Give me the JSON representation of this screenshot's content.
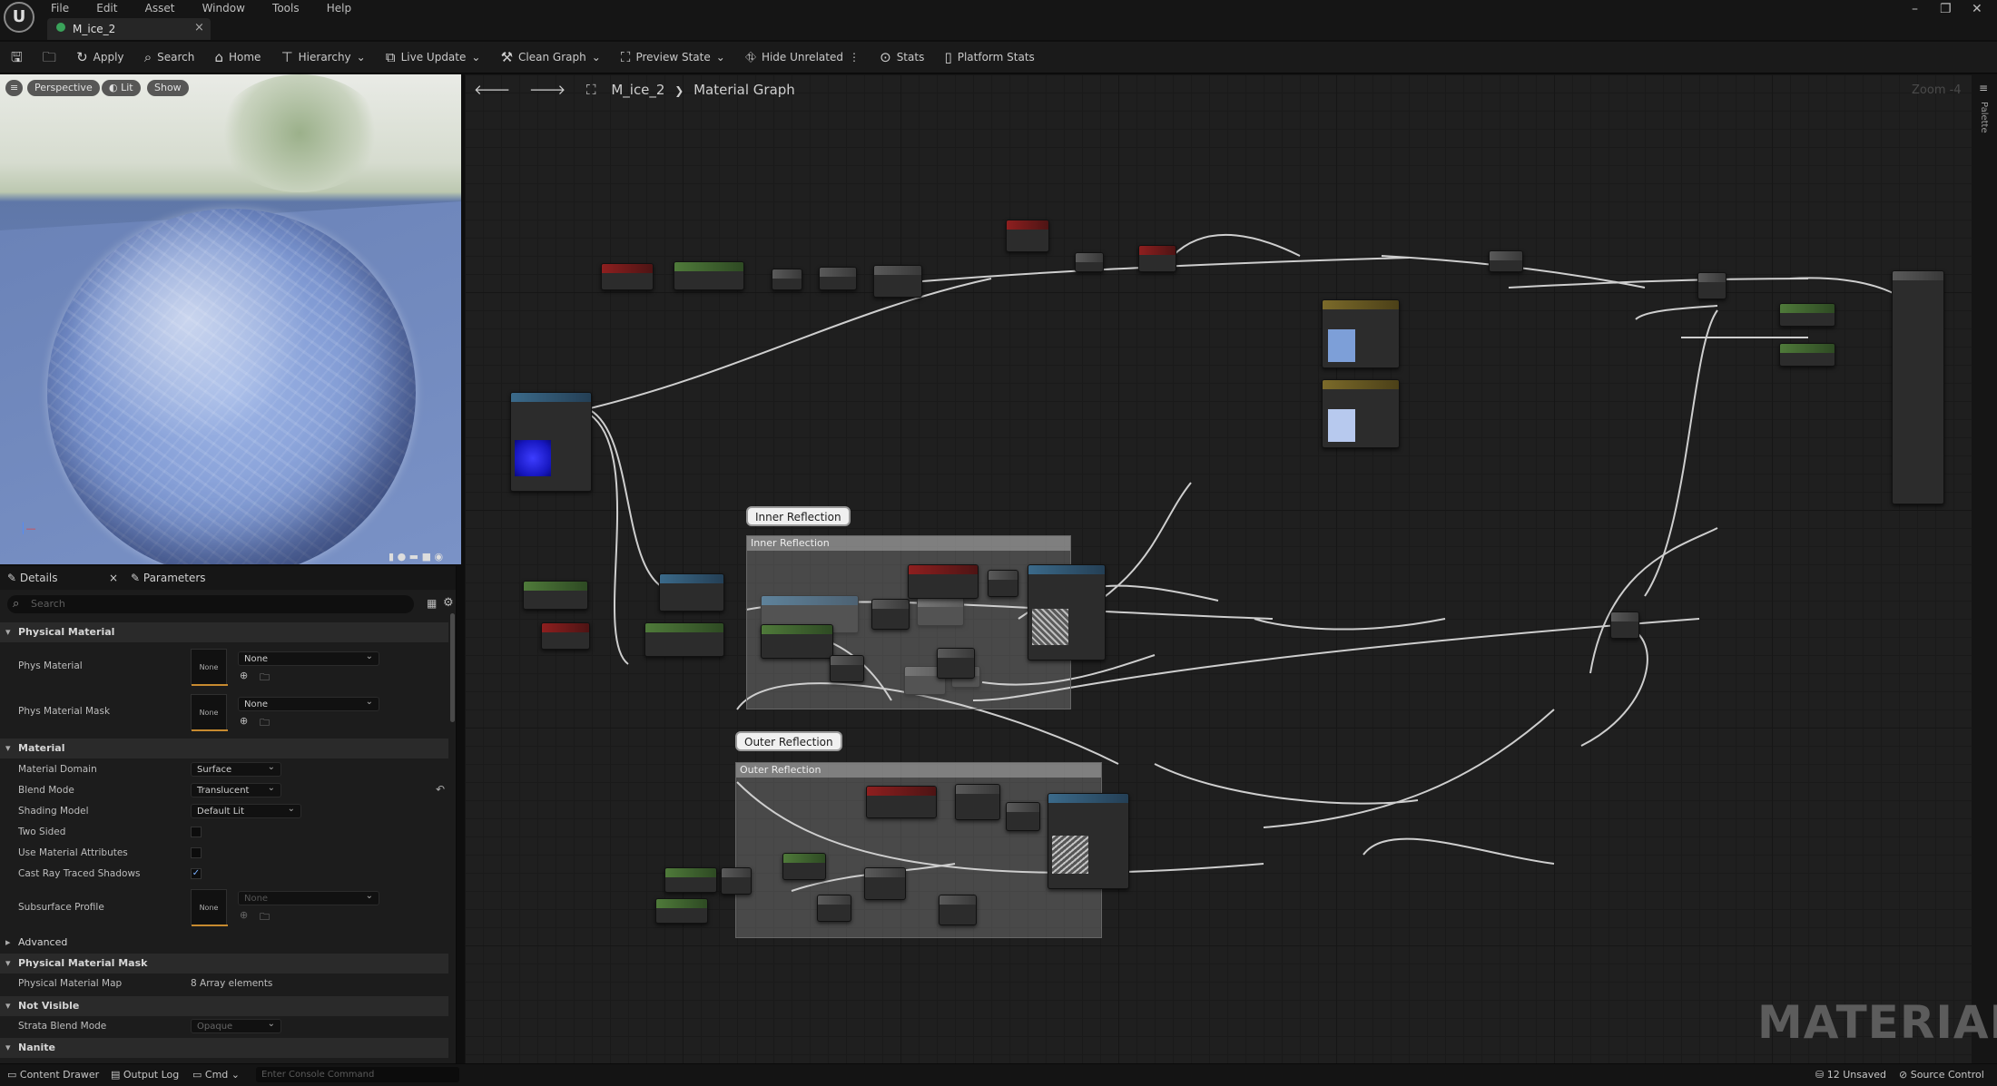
{
  "menu": [
    "File",
    "Edit",
    "Asset",
    "Window",
    "Tools",
    "Help"
  ],
  "logo": "U",
  "asset_tab": {
    "title": "M_ice_2",
    "close": "×"
  },
  "window_controls": {
    "minimize": "–",
    "restore": "❐",
    "close": "✕"
  },
  "toolbar": {
    "apply": "Apply",
    "search": "Search",
    "home": "Home",
    "hierarchy": "Hierarchy",
    "live_update": "Live Update",
    "clean_graph": "Clean Graph",
    "preview_state": "Preview State",
    "hide_unrelated": "Hide Unrelated",
    "stats": "Stats",
    "platform_stats": "Platform Stats"
  },
  "viewport": {
    "perspective": "Perspective",
    "lit": "Lit",
    "show": "Show"
  },
  "details": {
    "tab_details": "Details",
    "tab_close": "×",
    "tab_parameters": "Parameters",
    "search_placeholder": "Search",
    "sections": {
      "physical_material": "Physical Material",
      "material": "Material",
      "advanced": "Advanced",
      "physical_material_mask": "Physical Material Mask",
      "not_visible": "Not Visible",
      "nanite": "Nanite"
    },
    "phys_material": {
      "label": "Phys Material",
      "thumb": "None",
      "value": "None"
    },
    "phys_material_mask": {
      "label": "Phys Material Mask",
      "thumb": "None",
      "value": "None"
    },
    "material_domain": {
      "label": "Material Domain",
      "value": "Surface"
    },
    "blend_mode": {
      "label": "Blend Mode",
      "value": "Translucent"
    },
    "shading_model": {
      "label": "Shading Model",
      "value": "Default Lit"
    },
    "two_sided": {
      "label": "Two Sided"
    },
    "use_material_attributes": {
      "label": "Use Material Attributes"
    },
    "cast_ray_traced_shadows": {
      "label": "Cast Ray Traced Shadows",
      "checked": "✓"
    },
    "subsurface_profile": {
      "label": "Subsurface Profile",
      "thumb": "None",
      "value": "None"
    },
    "physical_material_map": {
      "label": "Physical Material Map",
      "value": "8 Array elements"
    },
    "strata_blend_mode": {
      "label": "Strata Blend Mode",
      "value": "Opaque"
    }
  },
  "graph": {
    "breadcrumb_root": "M_ice_2",
    "breadcrumb_sep": "❯",
    "breadcrumb_current": "Material Graph",
    "zoom": "Zoom -4",
    "comments": {
      "inner_bubble": "Inner Reflection",
      "inner_header": "Inner Reflection",
      "outer_bubble": "Outer Reflection",
      "outer_header": "Outer Reflection"
    },
    "palette": "Palette",
    "watermark": "MATERIAL"
  },
  "statusbar": {
    "content_drawer": "Content Drawer",
    "output_log": "Output Log",
    "cmd": "Cmd",
    "console_placeholder": "Enter Console Command",
    "unsaved": "12 Unsaved",
    "source_control": "Source Control"
  },
  "colors": {
    "accent": "#c78a2f",
    "node_red": "#8e1f1f",
    "node_green": "#4f7a3a",
    "node_teal": "#3b6a8a",
    "preview_blue": "#2424d8",
    "color_swatch": "#7d9fd8"
  }
}
